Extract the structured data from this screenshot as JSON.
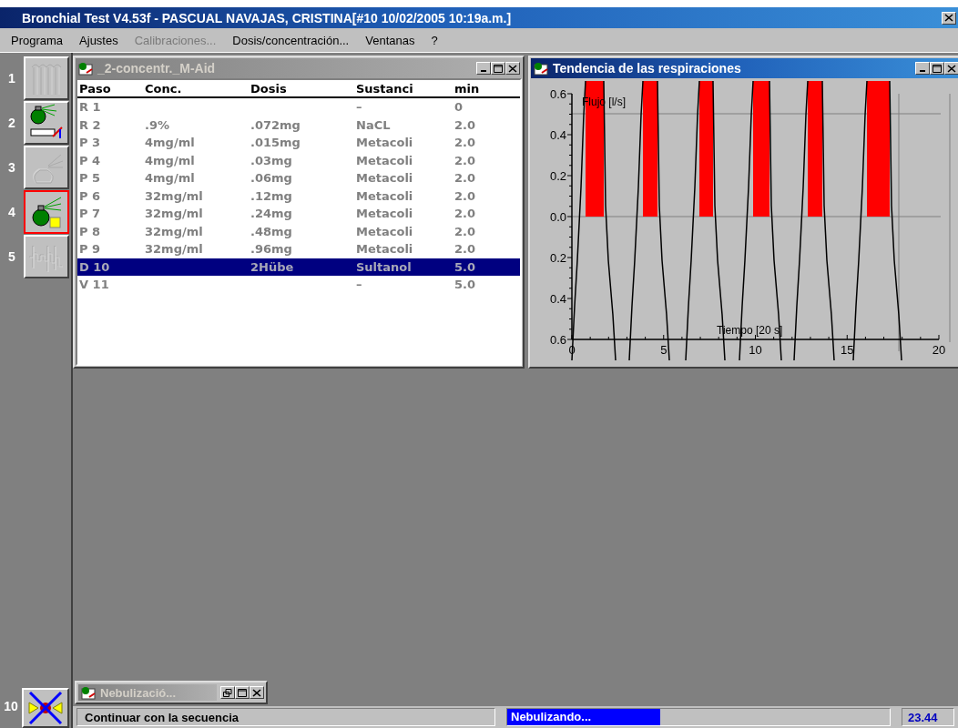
{
  "window": {
    "title": "Bronchial Test V4.53f - PASCUAL NAVAJAS, CRISTINA[#10 10/02/2005 10:19a.m.]"
  },
  "menu": [
    {
      "label": "Programa",
      "disabled": false
    },
    {
      "label": "Ajustes",
      "disabled": false
    },
    {
      "label": "Calibraciones...",
      "disabled": true
    },
    {
      "label": "Dosis/concentración...",
      "disabled": false
    },
    {
      "label": "Ventanas",
      "disabled": false
    },
    {
      "label": "?",
      "disabled": false
    }
  ],
  "toolbar": [
    {
      "number": "1",
      "kind": "bars",
      "disabled": true,
      "selected": false
    },
    {
      "number": "2",
      "kind": "calibration",
      "disabled": false,
      "selected": false
    },
    {
      "number": "3",
      "kind": "spray",
      "disabled": true,
      "selected": false
    },
    {
      "number": "4",
      "kind": "nebulizer",
      "disabled": false,
      "selected": true
    },
    {
      "number": "5",
      "kind": "waveform",
      "disabled": true,
      "selected": false
    }
  ],
  "bottom_button": {
    "number": "10"
  },
  "sequence_window": {
    "title": "_2-concentr._M-Aid",
    "active": false,
    "columns": [
      "Paso",
      "Conc.",
      "Dosis",
      "Sustanci",
      "min"
    ],
    "rows": [
      {
        "paso": "R 1",
        "sustancia": "–",
        "min": "0",
        "selected": false
      },
      {
        "paso": "R 2",
        "conc": ".9%",
        "dosis": ".072mg",
        "sustancia": "NaCL",
        "min": "2.0",
        "selected": false
      },
      {
        "paso": "P 3",
        "conc": "4mg/ml",
        "dosis": ".015mg",
        "sustancia": "Metacoli",
        "min": "2.0",
        "selected": false
      },
      {
        "paso": "P 4",
        "conc": "4mg/ml",
        "dosis": ".03mg",
        "sustancia": "Metacoli",
        "min": "2.0",
        "selected": false
      },
      {
        "paso": "P 5",
        "conc": "4mg/ml",
        "dosis": ".06mg",
        "sustancia": "Metacoli",
        "min": "2.0",
        "selected": false
      },
      {
        "paso": "P 6",
        "conc": "32mg/ml",
        "dosis": ".12mg",
        "sustancia": "Metacoli",
        "min": "2.0",
        "selected": false
      },
      {
        "paso": "P 7",
        "conc": "32mg/ml",
        "dosis": ".24mg",
        "sustancia": "Metacoli",
        "min": "2.0",
        "selected": false
      },
      {
        "paso": "P 8",
        "conc": "32mg/ml",
        "dosis": ".48mg",
        "sustancia": "Metacoli",
        "min": "2.0",
        "selected": false
      },
      {
        "paso": "P 9",
        "conc": "32mg/ml",
        "dosis": ".96mg",
        "sustancia": "Metacoli",
        "min": "2.0",
        "selected": false
      },
      {
        "paso": "D 10",
        "dosis": "2Hübe",
        "sustancia": "Sultanol",
        "min": "5.0",
        "selected": true
      },
      {
        "paso": "V 11",
        "sustancia": "–",
        "min": "5.0",
        "selected": false
      }
    ]
  },
  "chart_window": {
    "title": "Tendencia de las respiraciones",
    "active": true,
    "y_label": "Flujo [l/s]",
    "x_label": "Tiempo [20 s]",
    "y_ticks": [
      "0.6",
      "0.4",
      "0.2",
      "0.0",
      "0.2",
      "0.4",
      "0.6"
    ],
    "x_ticks": [
      "0",
      "5",
      "10",
      "15",
      "20"
    ]
  },
  "minimized_window": {
    "title": "Nebulizació...",
    "active": false
  },
  "status_bar": {
    "message": "Continuar con la secuencia",
    "progress": {
      "label": "Nebulizando...",
      "level": 0.4
    },
    "value": "23.44"
  }
}
